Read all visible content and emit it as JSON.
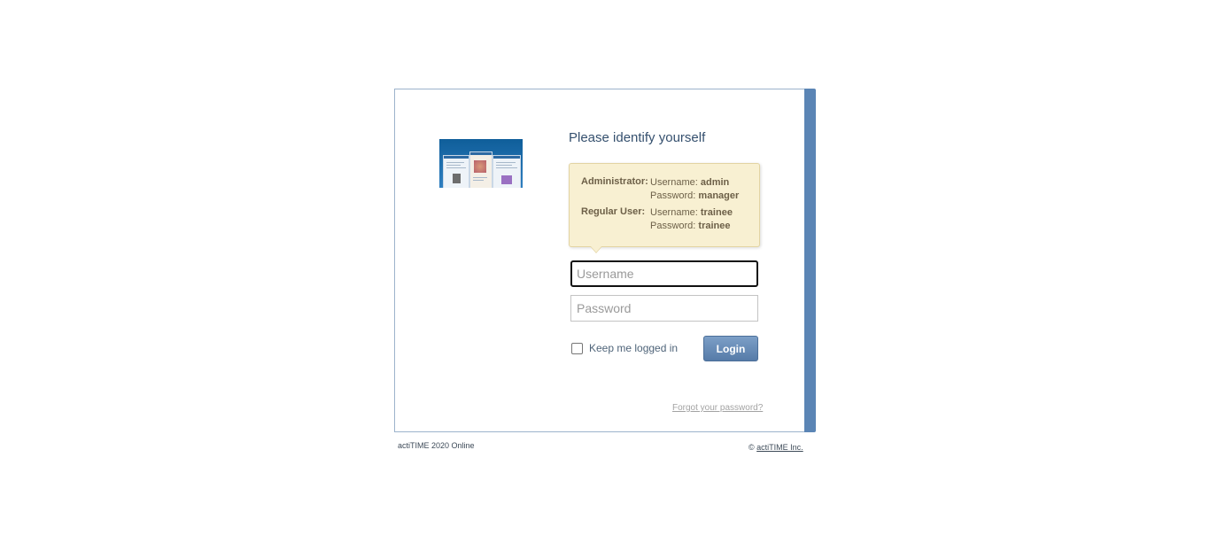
{
  "login": {
    "title": "Please identify yourself",
    "hint": {
      "admin_role": "Administrator:",
      "admin_username_label": "Username:",
      "admin_username": "admin",
      "admin_password_label": "Password:",
      "admin_password": "manager",
      "user_role": "Regular User:",
      "user_username_label": "Username:",
      "user_username": "trainee",
      "user_password_label": "Password:",
      "user_password": "trainee"
    },
    "username_placeholder": "Username",
    "password_placeholder": "Password",
    "remember_label": "Keep me logged in",
    "login_label": "Login",
    "forgot_label": "Forgot your password?"
  },
  "footer": {
    "product": "actiTIME 2020 Online",
    "copyright_symbol": "©",
    "company": "actiTIME Inc."
  },
  "colors": {
    "accent": "#5b85b5",
    "hint_background": "#f8f0d2",
    "button": "#567ba8"
  }
}
